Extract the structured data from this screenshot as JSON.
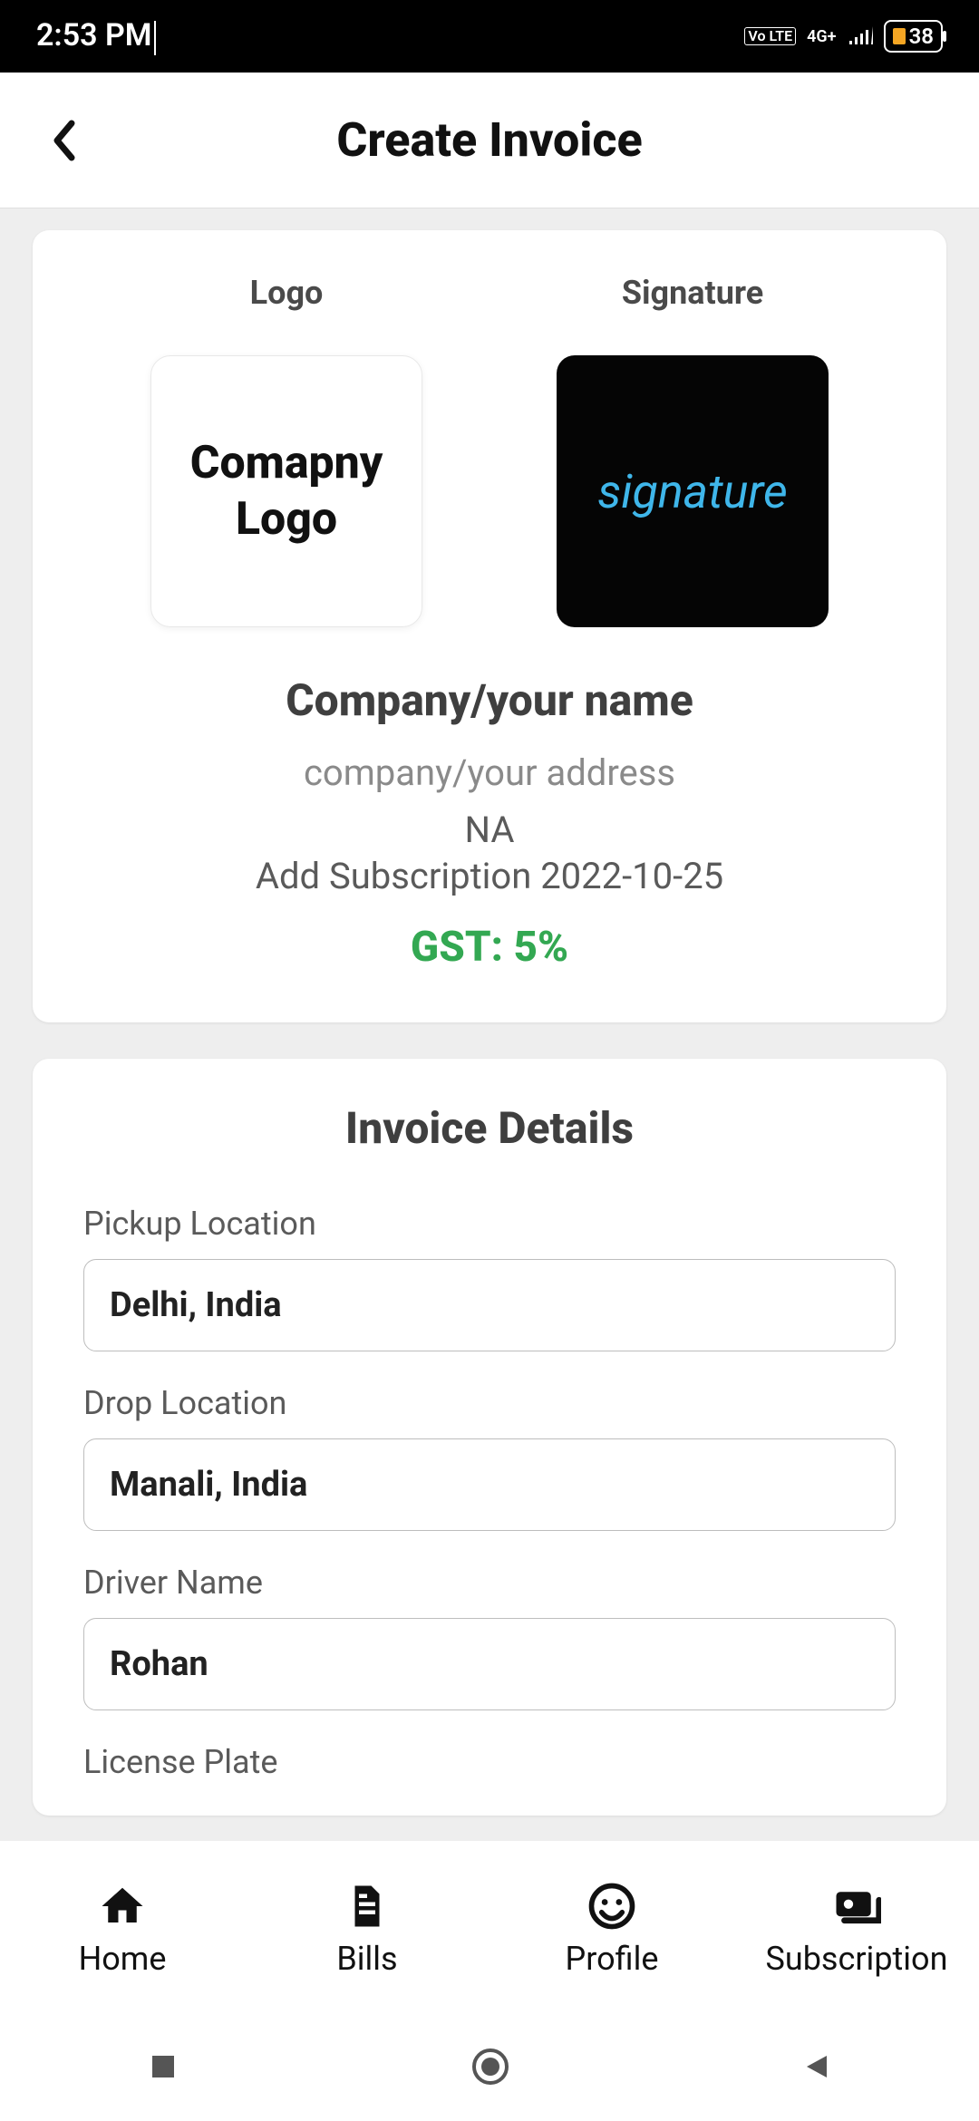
{
  "status": {
    "time": "2:53 PM",
    "volte": "Vo LTE",
    "network": "4G+",
    "battery": "38"
  },
  "appbar": {
    "title": "Create Invoice"
  },
  "company_card": {
    "logo_label": "Logo",
    "signature_label": "Signature",
    "logo_text_line1": "Comapny",
    "logo_text_line2": "Logo",
    "signature_text": "signature",
    "company_name": "Company/your name",
    "company_address": "company/your address",
    "na": "NA",
    "subscription_line": "Add Subscription 2022-10-25",
    "gst": "GST: 5%"
  },
  "invoice_details": {
    "title": "Invoice Details",
    "fields": {
      "pickup": {
        "label": "Pickup Location",
        "value": "Delhi, India"
      },
      "drop": {
        "label": "Drop Location",
        "value": "Manali, India"
      },
      "driver": {
        "label": "Driver Name",
        "value": "Rohan"
      },
      "license": {
        "label": "License Plate",
        "value": ""
      }
    }
  },
  "nav": {
    "home": "Home",
    "bills": "Bills",
    "profile": "Profile",
    "subscription": "Subscription"
  }
}
